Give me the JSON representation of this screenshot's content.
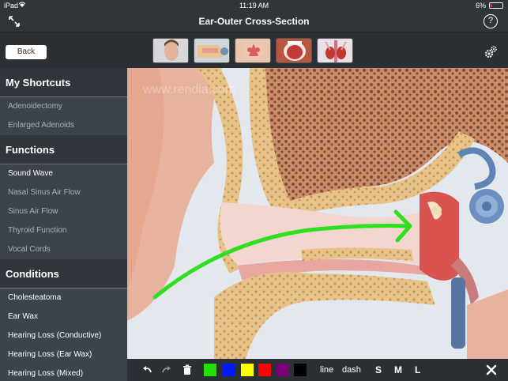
{
  "status": {
    "device": "iPad",
    "time": "11:19 AM",
    "battery": "6%"
  },
  "window": {
    "title": "Ear-Outer Cross-Section"
  },
  "toolbar": {
    "back_label": "Back",
    "thumbnails": [
      {
        "name": "face-thumbnail"
      },
      {
        "name": "ear-thumbnail"
      },
      {
        "name": "nasal-thumbnail"
      },
      {
        "name": "throat-thumbnail"
      },
      {
        "name": "thyroid-thumbnail"
      }
    ]
  },
  "sidebar": {
    "sections": [
      {
        "title": "My Shortcuts",
        "items": [
          {
            "label": "Adenoidectomy",
            "dim": true
          },
          {
            "label": "Enlarged Adenoids",
            "dim": true
          }
        ]
      },
      {
        "title": "Functions",
        "items": [
          {
            "label": "Sound Wave",
            "dim": false
          },
          {
            "label": "Nasal Sinus Air Flow",
            "dim": true
          },
          {
            "label": "Sinus Air Flow",
            "dim": true
          },
          {
            "label": "Thyroid Function",
            "dim": true
          },
          {
            "label": "Vocal Cords",
            "dim": true
          }
        ]
      },
      {
        "title": "Conditions",
        "items": [
          {
            "label": "Cholesteatoma",
            "dim": false
          },
          {
            "label": "Ear Wax",
            "dim": false
          },
          {
            "label": "Hearing Loss (Conductive)",
            "dim": false
          },
          {
            "label": "Hearing Loss (Ear Wax)",
            "dim": false
          },
          {
            "label": "Hearing Loss (Mixed)",
            "dim": false
          }
        ]
      }
    ]
  },
  "image": {
    "watermark": "www.rendia.com"
  },
  "drawbar": {
    "colors": [
      "#22e000",
      "#0018ff",
      "#ffff00",
      "#ff0000",
      "#7a007a",
      "#000000"
    ],
    "line_label": "line",
    "dash_label": "dash",
    "sizes": [
      "S",
      "M",
      "L"
    ]
  }
}
